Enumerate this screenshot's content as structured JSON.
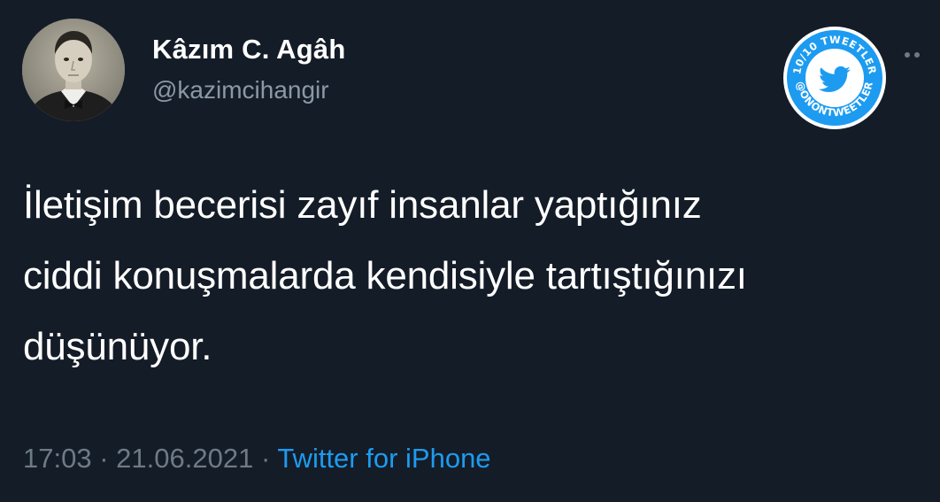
{
  "user": {
    "display_name": "Kâzım C. Agâh",
    "handle": "@kazimcihangir"
  },
  "tweet": {
    "text": "İletişim becerisi zayıf insanlar yaptığınız\nciddi konuşmalarda kendisiyle tartıştığınızı\ndüşünüyor."
  },
  "meta": {
    "time": "17:03",
    "separator": "·",
    "date": "21.06.2021",
    "source": "Twitter for iPhone"
  },
  "badge": {
    "top_text": "10/10 TWEETLER",
    "bottom_text": "@ONONTWEETLER",
    "icon": "twitter-bird-icon"
  },
  "colors": {
    "background": "#141c27",
    "handle": "#8b98a5",
    "meta": "#6e7a86",
    "link": "#1d9bf0",
    "badge_ring": "#1d9bf0"
  }
}
